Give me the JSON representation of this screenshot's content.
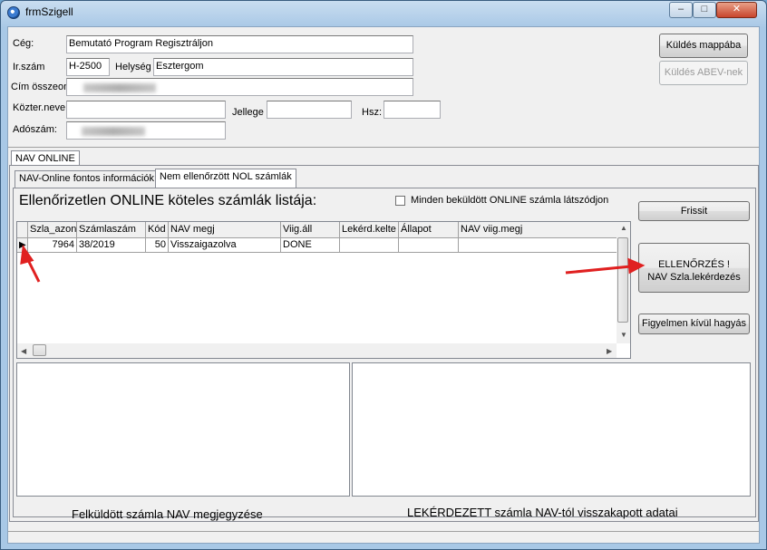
{
  "window": {
    "title": "frmSzigell",
    "min_label": "–",
    "max_label": "□",
    "close_label": "✕"
  },
  "form": {
    "ceg_label": "Cég:",
    "ceg_value": "Bemutató Program Regisztráljon",
    "irszam_label": "Ir.szám",
    "irszam_value": "H-2500",
    "helyseg_label": "Helység",
    "helyseg_value": "Esztergom",
    "cim_label": "Cím összeonl",
    "kozter_label": "Közter.neve",
    "jellege_label": "Jellege",
    "hsz_label": "Hsz:",
    "adoszam_label": "Adószám:"
  },
  "buttons": {
    "kuldes_mappaba": "Küldés mappába",
    "kuldes_abev": "Küldés ABEV-nek",
    "frissit": "Frissit",
    "ellenorzes_line1": "ELLENŐRZÉS !",
    "ellenorzes_line2": "NAV Szla.lekérdezés",
    "figyelmen": "Figyelmen kívül hagyás"
  },
  "tabs": {
    "main": "NAV ONLINE",
    "sub1": "NAV-Online fontos információk",
    "sub2": "Nem ellenőrzött NOL számlák"
  },
  "list": {
    "title": "Ellenőrizetlen ONLINE köteles számlák listája:",
    "checkbox_label": "Minden beküldött ONLINE számla látszódjon",
    "columns": [
      "Szla_azon",
      "Számlaszám",
      "Kód",
      "NAV megj",
      "Viig.áll",
      "Lekérd.kelte",
      "Állapot",
      "NAV viig.megj"
    ],
    "rows": [
      [
        "7964",
        "38/2019",
        "50",
        "Visszaigazolva",
        "DONE",
        "",
        "",
        ""
      ]
    ]
  },
  "footer": {
    "left": "Felküldött számla  NAV megjegyzése",
    "right": "LEKÉRDEZETT  számla  NAV-tól visszakapott adatai"
  },
  "colors": {
    "annotation_arrow": "#e02020"
  }
}
